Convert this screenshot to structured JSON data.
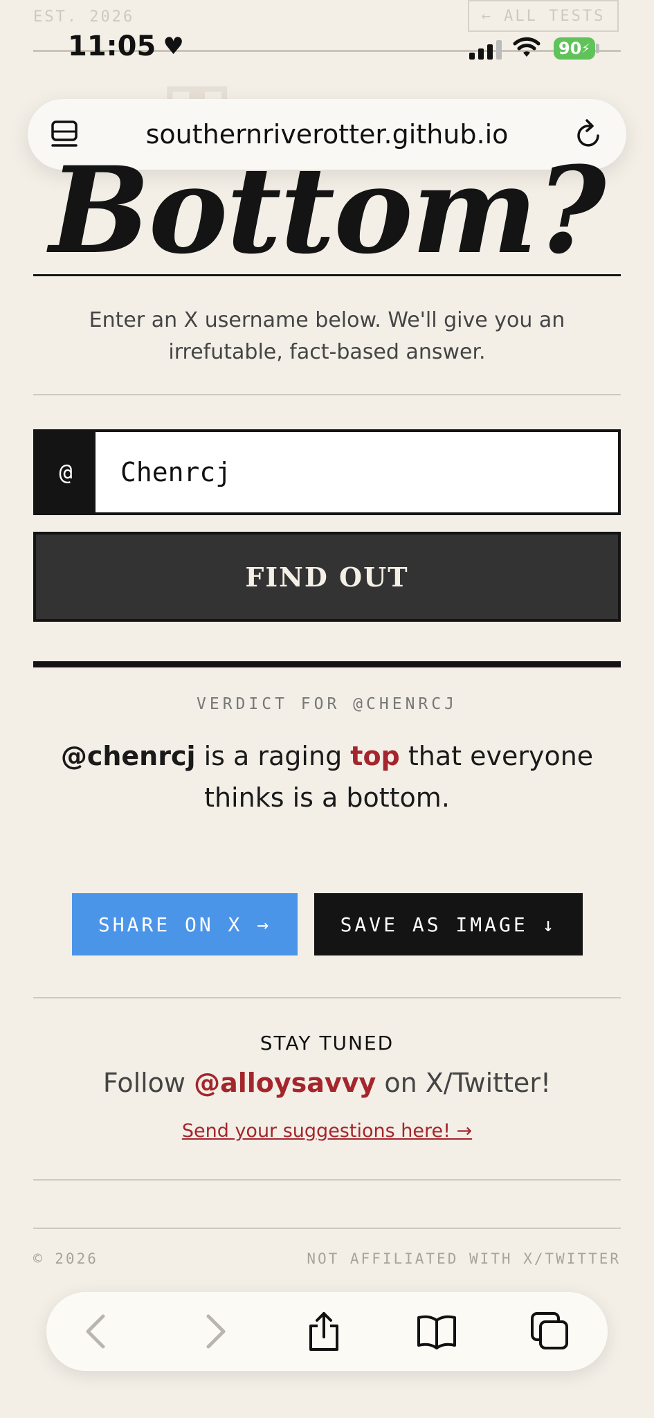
{
  "site_header": {
    "est": "EST. 2026",
    "all_tests": "← ALL TESTS",
    "ghost_title": "Top or"
  },
  "status_bar": {
    "time": "11:05",
    "battery": "90"
  },
  "browser": {
    "url": "southernriverotter.github.io"
  },
  "hero": {
    "title": "Bottom?",
    "intro": "Enter an X username below. We'll give you an irrefutable, fact-based answer."
  },
  "form": {
    "at_symbol": "@",
    "username_value": "Chenrcj",
    "submit_label": "FIND OUT"
  },
  "result": {
    "label": "VERDICT FOR @CHENRCJ",
    "handle": "@chenrcj",
    "text_1": " is a raging ",
    "keyword": "top",
    "text_2": " that everyone thinks is a bottom."
  },
  "actions": {
    "share_label": "SHARE ON X →",
    "save_label": "SAVE AS IMAGE ↓"
  },
  "follow": {
    "heading": "STAY TUNED",
    "prefix": "Follow ",
    "handle": "@alloysavvy",
    "suffix": " on X/Twitter!",
    "suggest_link": "Send your suggestions here! →"
  },
  "footer": {
    "copyright": "© 2026",
    "disclaimer": "NOT AFFILIATED WITH X/TWITTER"
  },
  "colors": {
    "background": "#f3efe7",
    "accent_red": "#a4262c",
    "share_blue": "#4b95e9",
    "battery_green": "#5fc35a"
  },
  "icons": [
    "tabs-icon",
    "reload-icon",
    "back-arrow-icon",
    "forward-arrow-icon",
    "share-icon",
    "bookmarks-icon",
    "tabs-overview-icon",
    "heart-icon",
    "signal-icon",
    "wifi-icon",
    "battery-icon"
  ]
}
